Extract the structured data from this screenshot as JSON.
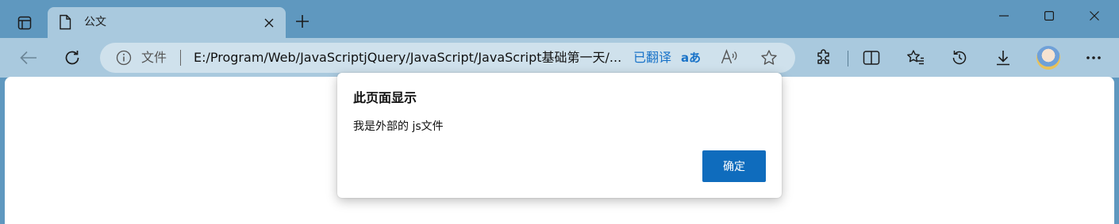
{
  "colors": {
    "titlebar": "#5f98bf",
    "toolbar": "#a9c9de",
    "active_tab": "#a9c9de",
    "address_bar": "#cfe1ec",
    "accent_link": "#1a73c8",
    "dialog_button": "#0f6cbd"
  },
  "tab": {
    "title": "公文",
    "icon": "page-icon"
  },
  "window_controls": [
    "minimize-icon",
    "maximize-icon",
    "close-icon"
  ],
  "toolbar": {
    "back_icon": "back-arrow-icon",
    "refresh_icon": "refresh-icon",
    "address": {
      "scheme_label": "文件",
      "url": "E:/Program/Web/JavaScriptjQuery/JavaScript/JavaScript基础第一天/...",
      "translated_label": "已翻译",
      "translate_glyph": "aあ"
    },
    "right_icons": [
      "extensions-icon",
      "split-screen-icon",
      "favorites-icon",
      "history-icon",
      "downloads-icon",
      "profile-avatar",
      "more-icon"
    ]
  },
  "dialog": {
    "title": "此页面显示",
    "message": "我是外部的 js文件",
    "ok_label": "确定"
  }
}
